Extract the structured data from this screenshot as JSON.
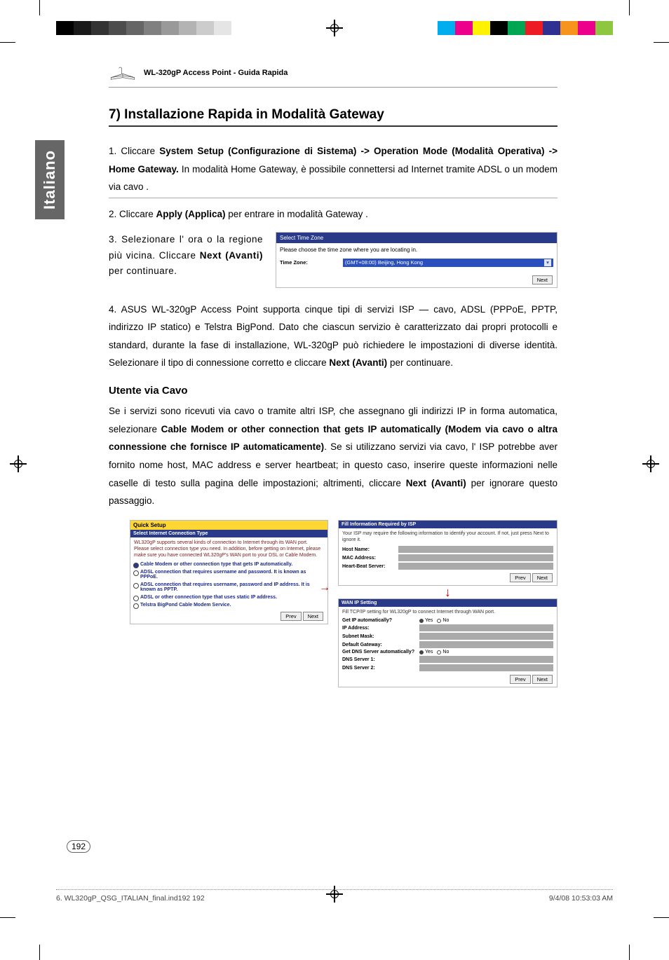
{
  "print": {
    "left_colors": [
      "#000",
      "#1a1a1a",
      "#333",
      "#4d4d4d",
      "#666",
      "#808080",
      "#999",
      "#b3b3b3",
      "#ccc",
      "#e5e5e5"
    ],
    "right_colors": [
      "#00aeef",
      "#ec008c",
      "#fff200",
      "#000000",
      "#00a651",
      "#ed1c24",
      "#2e3192",
      "#f7941d",
      "#ec008c",
      "#8dc63f"
    ]
  },
  "header": {
    "product": "WL-320gP Access Point - Guida Rapida"
  },
  "side_tab": "Italiano",
  "title": "7) Installazione Rapida in Modalità Gateway",
  "step1": {
    "prefix": "1. Cliccare ",
    "bold": "System Setup (Configurazione di Sistema) -> Operation Mode (Modalità Operativa) -> Home Gateway.",
    "suffix": " In modalità Home Gateway, è possibile connettersi ad Internet tramite ADSL o un modem via cavo ."
  },
  "step2": {
    "prefix": "2. Cliccare ",
    "bold": "Apply (Applica)",
    "suffix": " per entrare in modalità Gateway ."
  },
  "step3": {
    "prefix": "3. Selezionare l' ora o la regione più vicina. Cliccare ",
    "bold": "Next (Avanti)",
    "suffix": " per continuare."
  },
  "fig_tz": {
    "header": "Select Time Zone",
    "desc": "Please choose the time zone where you are locating in.",
    "label": "Time Zone:",
    "value": "(GMT+08:00) Beijing, Hong Kong",
    "next": "Next"
  },
  "step4": {
    "prefix": "4. ASUS WL-320gP Access Point supporta cinque tipi di servizi ISP — cavo, ADSL (PPPoE, PPTP, indirizzo IP statico) e Telstra BigPond. Dato che ciascun servizio è caratterizzato dai propri protocolli e standard, durante la fase di installazione, WL-320gP può richiedere le impostazioni di diverse identità. Selezionare il tipo di connessione corretto e cliccare ",
    "bold": "Next (Avanti)",
    "suffix": " per continuare."
  },
  "sub_heading": "Utente via Cavo",
  "cavo_para": {
    "prefix": "Se i servizi sono ricevuti via cavo o tramite altri ISP, che assegnano gli indirizzi IP in forma automatica, selezionare ",
    "bold": "Cable Modem or other connection that gets IP automatically (Modem via cavo o altra connessione che fornisce IP automaticamente)",
    "suffix": ". Se si utilizzano servizi via cavo, l' ISP potrebbe aver fornito nome host, MAC address e server heartbeat; in questo caso, inserire queste informazioni nelle caselle di testo sulla pagina delle impostazioni; altrimenti, cliccare ",
    "bold2": "Next (Avanti)",
    "suffix2": " per ignorare questo passaggio."
  },
  "quick_setup": {
    "title": "Quick Setup",
    "sub": "Select Internet Connection Type",
    "desc": "WL320gP supports several kinds of connection to Internet through its WAN port. Please select connection type you need. In addition, before getting on Internet, please make sure you have connected WL320gP's WAN port to your DSL or Cable Modem.",
    "options": [
      "Cable Modem or other connection type that gets IP automatically.",
      "ADSL connection that requires username and password. It is known as PPPoE.",
      "ADSL connection that requires username, password and IP address. It is known as PPTP.",
      "ADSL or other connection type that uses static IP address.",
      "Telstra BigPond Cable Modem Service."
    ],
    "prev": "Prev",
    "next": "Next"
  },
  "isp_info": {
    "title": "Fill Information Required by ISP",
    "desc": "Your ISP may require the following information to identify your account. If not, just press Next to ignore it.",
    "rows": [
      "Host Name:",
      "MAC Address:",
      "Heart-Beat Server:"
    ],
    "prev": "Prev",
    "next": "Next"
  },
  "wan": {
    "title": "WAN IP Setting",
    "desc": "Fill TCP/IP setting for WL320gP to connect Internet through WAN port.",
    "get_ip": "Get IP automatically?",
    "ip": "IP Address:",
    "mask": "Subnet Mask:",
    "gw": "Default Gateway:",
    "get_dns": "Get DNS Server automatically?",
    "dns1": "DNS Server 1:",
    "dns2": "DNS Server 2:",
    "yes": "Yes",
    "no": "No",
    "prev": "Prev",
    "next": "Next"
  },
  "page_number": "192",
  "footer": {
    "left": "6. WL320gP_QSG_ITALIAN_final.ind192   192",
    "right": "9/4/08   10:53:03 AM"
  }
}
